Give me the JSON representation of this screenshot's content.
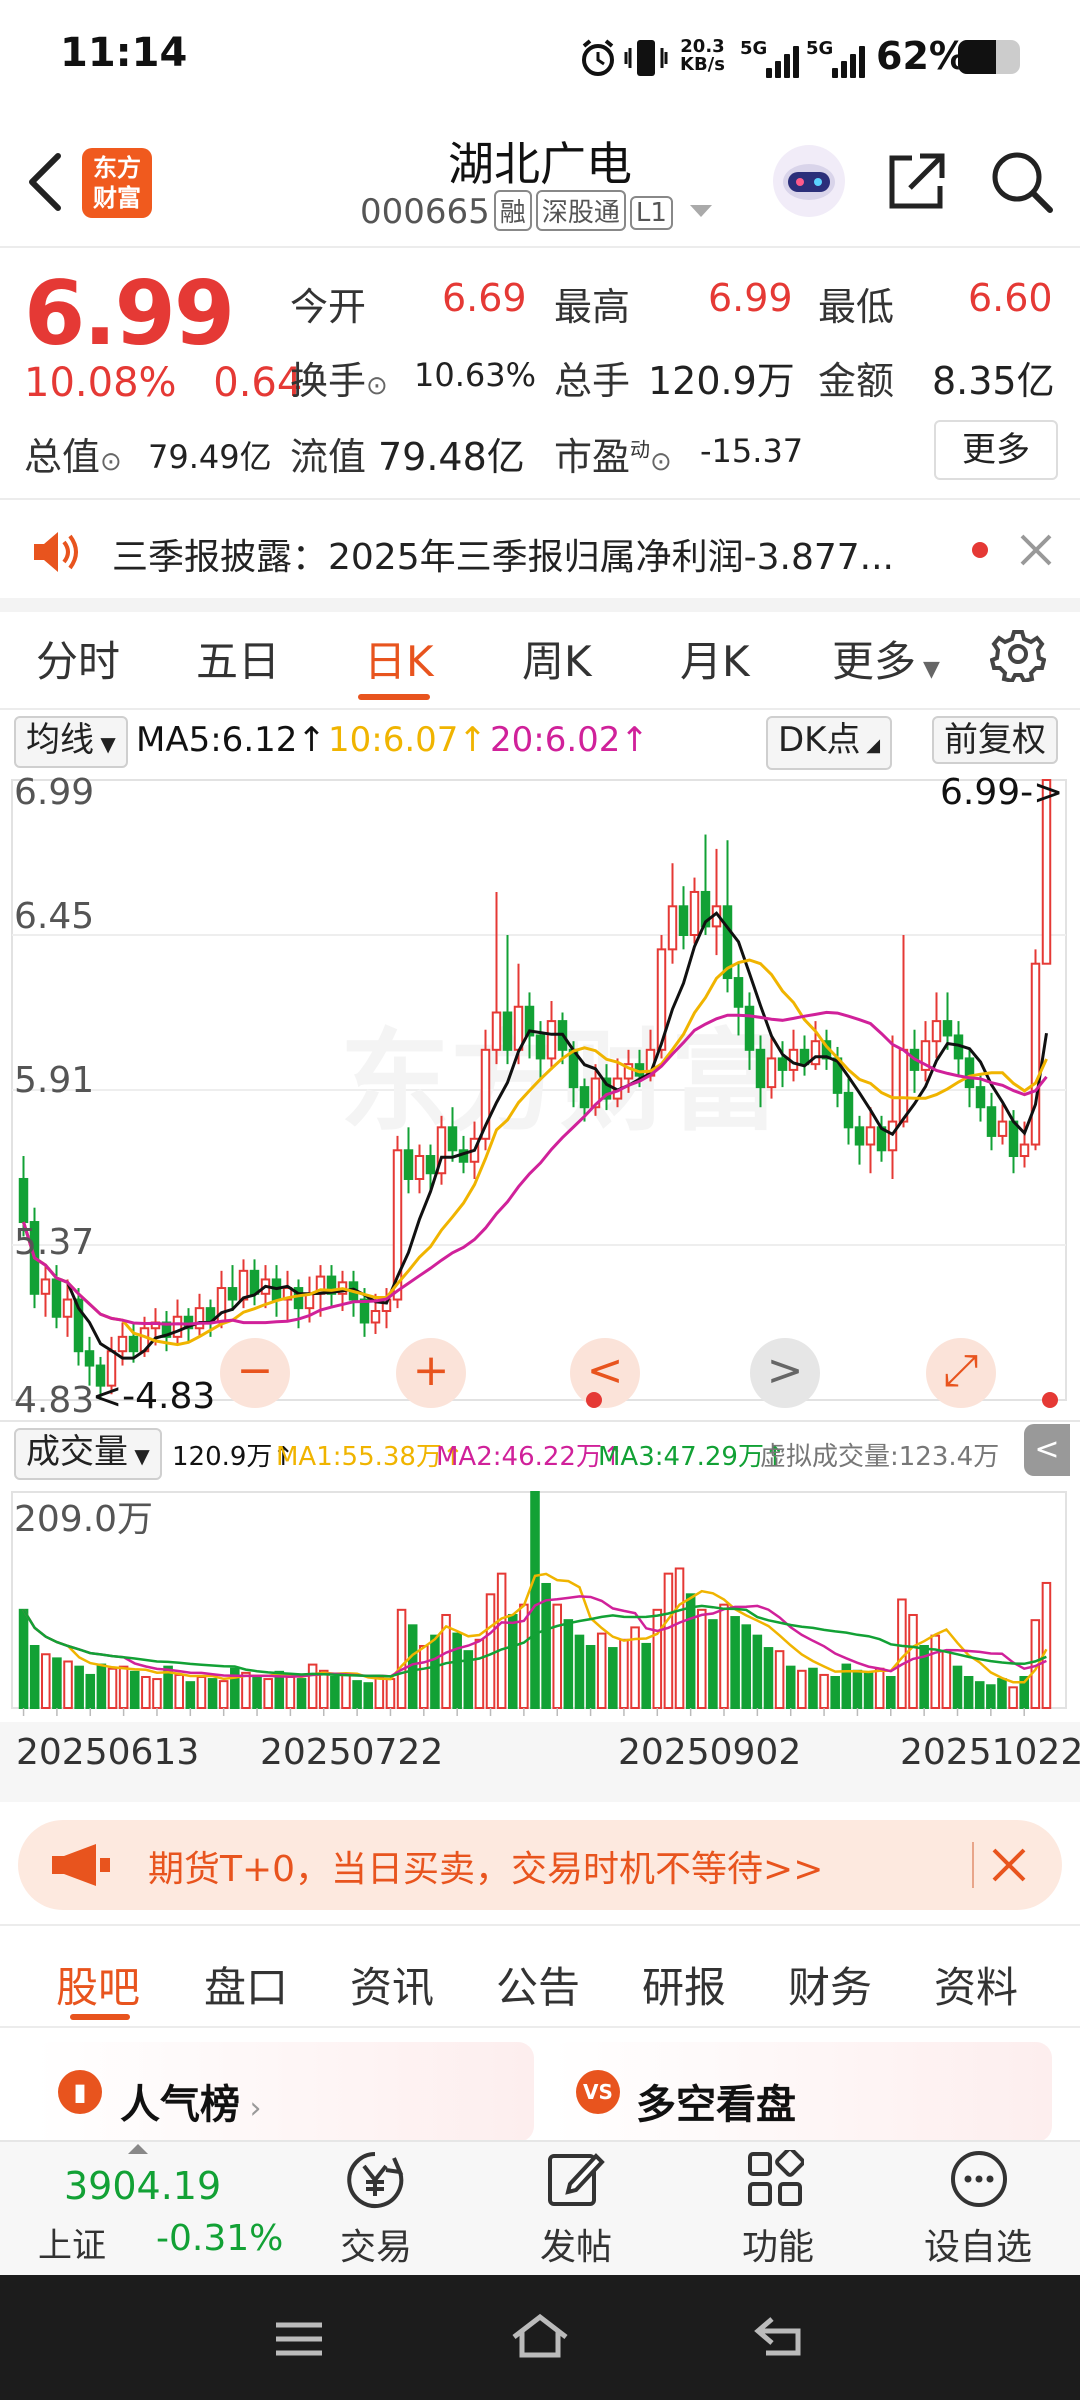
{
  "status_bar": {
    "time": "11:14",
    "net_speed_value": "20.3",
    "net_speed_unit": "KB/s",
    "sim1": "5G",
    "sim2": "5G",
    "battery": "62%"
  },
  "header": {
    "brand_logo": "东方\n财富",
    "title": "湖北广电",
    "code": "000665",
    "tags": [
      "融",
      "深股通",
      "L1"
    ]
  },
  "quote": {
    "price": "6.99",
    "change_pct": "10.08%",
    "change": "0.64",
    "open_label": "今开",
    "open": "6.69",
    "high_label": "最高",
    "high": "6.99",
    "low_label": "最低",
    "low": "6.60",
    "turnover_label": "换手",
    "turnover": "10.63%",
    "volume_label": "总手",
    "volume": "120.9万",
    "amount_label": "金额",
    "amount": "8.35亿",
    "mcap_label": "总值",
    "mcap": "79.49亿",
    "float_label": "流值",
    "float": "79.48亿",
    "pe_label": "市盈",
    "pe_sup": "动",
    "pe": "-15.37",
    "more_label": "更多"
  },
  "notice": {
    "text": "三季报披露：2025年三季报归属净利润-3.877..."
  },
  "kline_tabs": [
    "分时",
    "五日",
    "日K",
    "周K",
    "月K",
    "更多"
  ],
  "kline_active": "日K",
  "chart_header": {
    "ma_selector": "均线",
    "ma5": "MA5:6.12↑",
    "ma10": "10:6.07↑",
    "ma20": "20:6.02↑",
    "dk_button": "DK点",
    "adjust_button": "前复权"
  },
  "volume_header": {
    "selector": "成交量",
    "vol": "120.9万↑",
    "ma1": "MA1:55.38万↑",
    "ma2": "MA2:46.22万↑",
    "ma3": "MA3:47.29万↑",
    "virtual": "虚拟成交量:123.4万"
  },
  "chart_data": [
    {
      "type": "candlestick",
      "title": "日K",
      "y_ticks": [
        "6.99",
        "6.45",
        "5.91",
        "5.37",
        "4.83"
      ],
      "ylim": [
        4.83,
        6.99
      ],
      "max_marker": "6.99->",
      "min_marker": "<-4.83",
      "x_ticks": [
        "20250613",
        "20250722",
        "20250902",
        "20251022"
      ],
      "series": [
        {
          "name": "MA5",
          "last": 6.12,
          "color": "#111111"
        },
        {
          "name": "MA10",
          "last": 6.07,
          "color": "#f0b400"
        },
        {
          "name": "MA20",
          "last": 6.02,
          "color": "#d0219a"
        }
      ],
      "candles": [
        [
          5.6,
          5.45,
          5.68,
          5.4
        ],
        [
          5.45,
          5.2,
          5.5,
          5.15
        ],
        [
          5.2,
          5.25,
          5.3,
          5.12
        ],
        [
          5.25,
          5.12,
          5.3,
          5.08
        ],
        [
          5.12,
          5.18,
          5.25,
          5.05
        ],
        [
          5.18,
          5.0,
          5.22,
          4.95
        ],
        [
          5.0,
          4.95,
          5.05,
          4.88
        ],
        [
          4.95,
          4.88,
          4.98,
          4.83
        ],
        [
          4.88,
          5.0,
          5.05,
          4.85
        ],
        [
          5.0,
          5.05,
          5.1,
          4.95
        ],
        [
          5.05,
          5.0,
          5.1,
          4.96
        ],
        [
          5.0,
          5.08,
          5.12,
          4.98
        ],
        [
          5.08,
          5.1,
          5.15,
          5.02
        ],
        [
          5.1,
          5.05,
          5.14,
          5.0
        ],
        [
          5.05,
          5.12,
          5.18,
          5.02
        ],
        [
          5.12,
          5.08,
          5.15,
          5.03
        ],
        [
          5.08,
          5.15,
          5.2,
          5.05
        ],
        [
          5.15,
          5.1,
          5.18,
          5.05
        ],
        [
          5.1,
          5.22,
          5.28,
          5.08
        ],
        [
          5.22,
          5.18,
          5.3,
          5.14
        ],
        [
          5.18,
          5.28,
          5.32,
          5.15
        ],
        [
          5.28,
          5.2,
          5.32,
          5.16
        ],
        [
          5.2,
          5.25,
          5.3,
          5.15
        ],
        [
          5.25,
          5.18,
          5.3,
          5.12
        ],
        [
          5.18,
          5.22,
          5.28,
          5.1
        ],
        [
          5.22,
          5.15,
          5.25,
          5.08
        ],
        [
          5.15,
          5.2,
          5.26,
          5.1
        ],
        [
          5.2,
          5.26,
          5.3,
          5.12
        ],
        [
          5.26,
          5.2,
          5.3,
          5.15
        ],
        [
          5.2,
          5.24,
          5.28,
          5.14
        ],
        [
          5.24,
          5.18,
          5.28,
          5.12
        ],
        [
          5.18,
          5.1,
          5.22,
          5.05
        ],
        [
          5.1,
          5.14,
          5.2,
          5.06
        ],
        [
          5.14,
          5.18,
          5.22,
          5.08
        ],
        [
          5.18,
          5.7,
          5.75,
          5.15
        ],
        [
          5.7,
          5.6,
          5.78,
          5.55
        ],
        [
          5.6,
          5.68,
          5.72,
          5.55
        ],
        [
          5.68,
          5.62,
          5.72,
          5.56
        ],
        [
          5.62,
          5.78,
          5.82,
          5.58
        ],
        [
          5.78,
          5.7,
          5.85,
          5.66
        ],
        [
          5.7,
          5.66,
          5.75,
          5.62
        ],
        [
          5.66,
          5.74,
          5.8,
          5.6
        ],
        [
          5.74,
          6.05,
          6.12,
          5.7
        ],
        [
          6.05,
          6.18,
          6.6,
          6.0
        ],
        [
          6.18,
          6.05,
          6.45,
          6.0
        ],
        [
          6.05,
          6.2,
          6.35,
          6.0
        ],
        [
          6.2,
          6.1,
          6.25,
          6.02
        ],
        [
          6.1,
          6.02,
          6.15,
          5.95
        ],
        [
          6.02,
          6.15,
          6.22,
          5.98
        ],
        [
          6.15,
          6.05,
          6.18,
          6.0
        ],
        [
          6.05,
          5.92,
          6.08,
          5.85
        ],
        [
          5.92,
          5.85,
          5.95,
          5.8
        ],
        [
          5.85,
          5.95,
          6.0,
          5.82
        ],
        [
          5.95,
          5.88,
          6.0,
          5.84
        ],
        [
          5.88,
          5.95,
          6.02,
          5.85
        ],
        [
          5.95,
          6.0,
          6.05,
          5.9
        ],
        [
          6.0,
          5.96,
          6.05,
          5.92
        ],
        [
          5.96,
          6.05,
          6.12,
          5.94
        ],
        [
          6.05,
          6.4,
          6.45,
          6.02
        ],
        [
          6.4,
          6.55,
          6.7,
          6.35
        ],
        [
          6.55,
          6.45,
          6.62,
          6.4
        ],
        [
          6.45,
          6.6,
          6.65,
          6.42
        ],
        [
          6.6,
          6.48,
          6.8,
          6.45
        ],
        [
          6.48,
          6.55,
          6.75,
          6.38
        ],
        [
          6.55,
          6.3,
          6.78,
          6.25
        ],
        [
          6.3,
          6.2,
          6.35,
          6.1
        ],
        [
          6.2,
          6.05,
          6.25,
          5.98
        ],
        [
          6.05,
          5.92,
          6.1,
          5.85
        ],
        [
          5.92,
          6.02,
          6.1,
          5.88
        ],
        [
          6.02,
          5.98,
          6.08,
          5.92
        ],
        [
          5.98,
          6.05,
          6.12,
          5.94
        ],
        [
          6.05,
          6.0,
          6.1,
          5.96
        ],
        [
          6.0,
          6.08,
          6.15,
          5.98
        ],
        [
          6.08,
          6.02,
          6.12,
          5.98
        ],
        [
          6.02,
          5.9,
          6.06,
          5.85
        ],
        [
          5.9,
          5.78,
          5.95,
          5.72
        ],
        [
          5.78,
          5.72,
          5.82,
          5.65
        ],
        [
          5.72,
          5.78,
          5.85,
          5.62
        ],
        [
          5.78,
          5.7,
          5.82,
          5.66
        ],
        [
          5.7,
          5.8,
          6.1,
          5.6
        ],
        [
          5.8,
          6.05,
          6.45,
          5.78
        ],
        [
          6.05,
          5.98,
          6.12,
          5.9
        ],
        [
          5.98,
          6.08,
          6.15,
          5.94
        ],
        [
          6.08,
          6.15,
          6.25,
          6.02
        ],
        [
          6.15,
          6.1,
          6.25,
          6.05
        ],
        [
          6.1,
          6.02,
          6.15,
          5.96
        ],
        [
          6.02,
          5.92,
          6.05,
          5.85
        ],
        [
          5.92,
          5.85,
          5.96,
          5.8
        ],
        [
          5.85,
          5.75,
          5.9,
          5.7
        ],
        [
          5.75,
          5.8,
          5.86,
          5.72
        ],
        [
          5.8,
          5.68,
          5.84,
          5.62
        ],
        [
          5.68,
          5.72,
          5.8,
          5.64
        ],
        [
          5.72,
          6.35,
          6.4,
          5.7
        ],
        [
          6.35,
          6.99,
          6.99,
          6.6
        ]
      ]
    },
    {
      "type": "bar",
      "title": "成交量",
      "y_tick": "209.0万",
      "ylim": [
        0,
        209
      ],
      "unit": "万",
      "series": [
        {
          "name": "MA1",
          "last": 55.38,
          "color": "#f0b400"
        },
        {
          "name": "MA2",
          "last": 46.22,
          "color": "#d0219a"
        },
        {
          "name": "MA3",
          "last": 47.29,
          "color": "#12a135"
        }
      ],
      "values": [
        95,
        60,
        52,
        48,
        45,
        40,
        32,
        42,
        38,
        40,
        35,
        30,
        28,
        40,
        32,
        25,
        30,
        28,
        26,
        38,
        34,
        30,
        28,
        35,
        30,
        28,
        42,
        36,
        30,
        32,
        26,
        24,
        30,
        28,
        95,
        80,
        60,
        70,
        90,
        72,
        55,
        66,
        110,
        130,
        90,
        100,
        209,
        120,
        100,
        85,
        70,
        60,
        72,
        58,
        66,
        78,
        62,
        95,
        130,
        135,
        110,
        95,
        85,
        100,
        88,
        80,
        70,
        58,
        55,
        40,
        36,
        38,
        32,
        30,
        42,
        36,
        34,
        38,
        30,
        105,
        90,
        60,
        70,
        55,
        40,
        30,
        25,
        22,
        28,
        20,
        30,
        85,
        121
      ]
    }
  ],
  "chart_controls": {
    "zoom_out": "−",
    "zoom_in": "+",
    "prev": "<",
    "next": ">",
    "fullscreen": "⤢"
  },
  "promo": {
    "text": "期货T+0，当日买卖，交易时机不等待>>"
  },
  "info_tabs": [
    "股吧",
    "盘口",
    "资讯",
    "公告",
    "研报",
    "财务",
    "资料"
  ],
  "info_active": "股吧",
  "cards": {
    "left_title": "人气榜",
    "right_title": "多空看盘",
    "right_badge": "VS"
  },
  "bottom_bar": {
    "index_value": "3904.19",
    "index_name": "上证",
    "index_change": "-0.31%",
    "items": [
      "交易",
      "发帖",
      "功能",
      "设自选"
    ]
  },
  "colors": {
    "up": "#e53935",
    "down": "#12a135",
    "accent": "#e8541e"
  }
}
